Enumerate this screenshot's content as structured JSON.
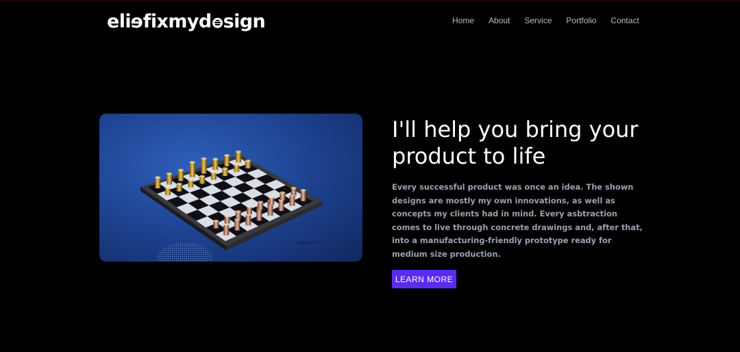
{
  "brand": {
    "logo_part1": "eli",
    "logo_part2": "fixmyd",
    "logo_part3": "sign"
  },
  "nav": {
    "items": [
      "Home",
      "About",
      "Service",
      "Portfolio",
      "Contact"
    ]
  },
  "hero": {
    "image_icon": "chess-board-image",
    "headline": "I'll help you bring your product to life",
    "description": "Every successful product was once an idea. The shown designs are mostly my own innovations, as well as concepts my clients had in mind. Every asbtraction comes to live through concrete drawings and, after that, into a manufacturing-friendly prototype ready for medium size production.",
    "cta_label": "LEARN MORE"
  },
  "colors": {
    "background": "#000000",
    "accent": "#5b2cf0",
    "nav_text": "#b6bcc8",
    "body_text": "#9aa2b1"
  }
}
